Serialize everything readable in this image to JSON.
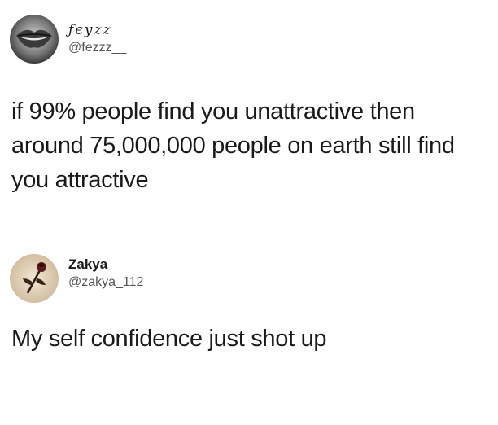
{
  "tweets": [
    {
      "display_name": "ƒєуzz",
      "handle": "@fezzz__",
      "text": "if 99% people find you unattractive then around 75,000,000 people on earth still find you attractive",
      "avatar_icon": "lips-photo-avatar"
    },
    {
      "display_name": "Zakya",
      "handle": "@zakya_112",
      "text": "My self confidence just shot up",
      "avatar_icon": "rose-photo-avatar"
    }
  ]
}
